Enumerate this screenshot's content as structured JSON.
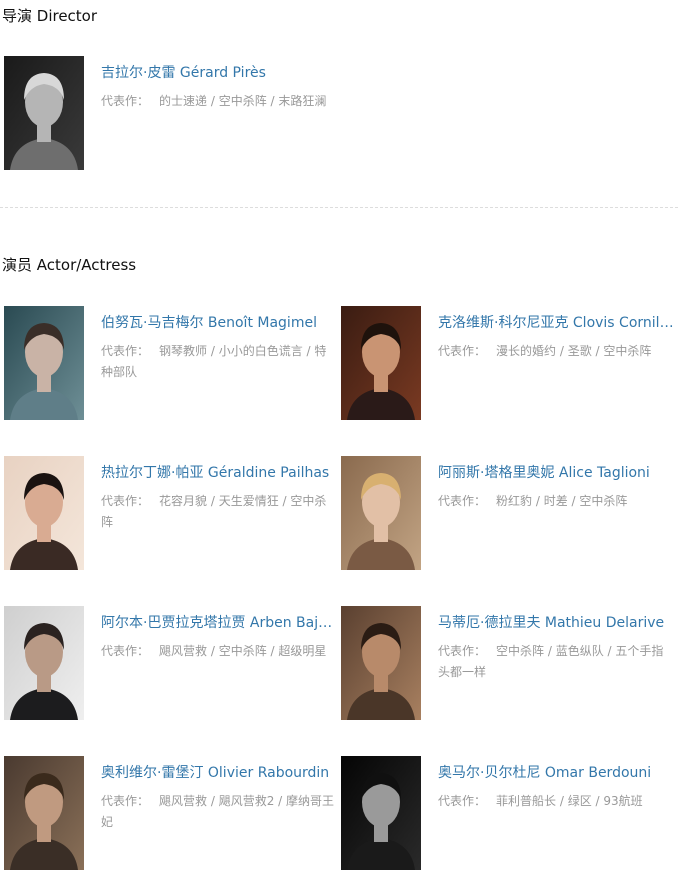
{
  "director_section": {
    "title": "导演 Director",
    "people": [
      {
        "name": "吉拉尔·皮雷 Gérard Pirès",
        "works_label": "代表作：",
        "works": "的士速递 / 空中杀阵 / 末路狂澜",
        "photo_style": "bw"
      }
    ]
  },
  "actor_section": {
    "title": "演员 Actor/Actress",
    "people": [
      {
        "name": "伯努瓦·马吉梅尔 Benoît Magimel",
        "works_label": "代表作：",
        "works": "钢琴教师 / 小小的白色谎言 / 特种部队",
        "photo_style": "teal"
      },
      {
        "name": "克洛维斯·科尔尼亚克 Clovis Cornillac",
        "works_label": "代表作：",
        "works": "漫长的婚约 / 圣歌 / 空中杀阵",
        "photo_style": "warm-dark"
      },
      {
        "name": "热拉尔丁娜·帕亚 Géraldine Pailhas",
        "works_label": "代表作：",
        "works": "花容月貌 / 天生爱情狂 / 空中杀阵",
        "photo_style": "warm-light"
      },
      {
        "name": "阿丽斯·塔格里奥妮 Alice Taglioni",
        "works_label": "代表作：",
        "works": "粉红豹 / 时差 / 空中杀阵",
        "photo_style": "blonde"
      },
      {
        "name": "阿尔本·巴贾拉克塔拉贾 Arben Bajraktaraj",
        "works_label": "代表作：",
        "works": "飓风营救 / 空中杀阵 / 超级明星",
        "photo_style": "light-gray"
      },
      {
        "name": "马蒂厄·德拉里夫 Mathieu Delarive",
        "works_label": "代表作：",
        "works": "空中杀阵 / 蓝色纵队 / 五个手指头都一样",
        "photo_style": "tan"
      },
      {
        "name": "奥利维尔·雷堡汀 Olivier Rabourdin",
        "works_label": "代表作：",
        "works": "飓风营救 / 飓风营救2 / 摩纳哥王妃",
        "photo_style": "warm-mid"
      },
      {
        "name": "奥马尔·贝尔杜尼 Omar Berdouni",
        "works_label": "代表作：",
        "works": "菲利普船长 / 绿区 / 93航班",
        "photo_style": "bw-dark"
      }
    ]
  }
}
